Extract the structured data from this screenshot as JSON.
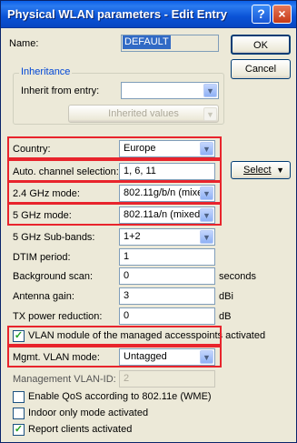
{
  "window": {
    "title": "Physical WLAN parameters - Edit Entry",
    "help_glyph": "?",
    "close_glyph": "×"
  },
  "name": {
    "label": "Name:",
    "value": "DEFAULT"
  },
  "buttons": {
    "ok": "OK",
    "cancel": "Cancel",
    "select": "Select",
    "inherited_values": "Inherited values"
  },
  "inheritance": {
    "legend": "Inheritance",
    "inherit_label": "Inherit from entry:",
    "inherit_value": ""
  },
  "fields": {
    "country": {
      "label": "Country:",
      "value": "Europe"
    },
    "auto_channel": {
      "label": "Auto. channel selection:",
      "value": "1, 6, 11"
    },
    "mode_24": {
      "label": "2.4 GHz mode:",
      "value": "802.11g/b/n (mixed)"
    },
    "mode_5": {
      "label": "5 GHz mode:",
      "value": "802.11a/n (mixed)"
    },
    "sub_bands": {
      "label": "5 GHz Sub-bands:",
      "value": "1+2"
    },
    "dtim": {
      "label": "DTIM period:",
      "value": "1"
    },
    "bg_scan": {
      "label": "Background scan:",
      "value": "0",
      "unit": "seconds"
    },
    "antenna_gain": {
      "label": "Antenna gain:",
      "value": "3",
      "unit": "dBi"
    },
    "tx_reduction": {
      "label": "TX power reduction:",
      "value": "0",
      "unit": "dB"
    },
    "mgmt_vlan_mode": {
      "label": "Mgmt. VLAN mode:",
      "value": "Untagged"
    },
    "mgmt_vlan_id": {
      "label": "Management VLAN-ID:",
      "value": "2"
    }
  },
  "checkboxes": {
    "vlan_module": {
      "label": "VLAN module of the managed accesspoints activated",
      "checked": true
    },
    "qos": {
      "label": "Enable QoS according to 802.11e (WME)",
      "checked": false
    },
    "indoor": {
      "label": "Indoor only mode activated",
      "checked": false
    },
    "report_clients": {
      "label": "Report clients activated",
      "checked": true
    }
  },
  "icons": {
    "dropdown": "chevron-down-icon",
    "check": "checkmark-icon"
  },
  "colors": {
    "highlight_border": "#e8242c",
    "titlebar": "#0a52d6",
    "selection": "#316ac5",
    "legend_text": "#0046d5"
  }
}
